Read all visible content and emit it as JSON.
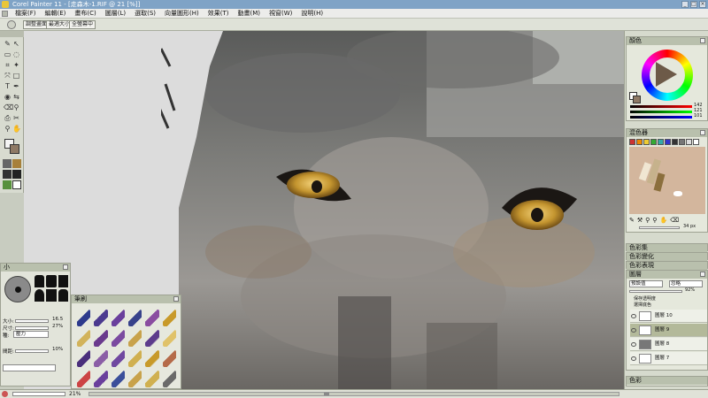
{
  "window": {
    "title": "Corel Painter 11 - [走森木-1.RIF @ 21 [%]]",
    "controls": [
      "_",
      "□",
      "×"
    ]
  },
  "menu": [
    "檔案(F)",
    "編輯(E)",
    "畫布(C)",
    "圖層(L)",
    "選取(S)",
    "向量圖形(H)",
    "效果(T)",
    "動畫(M)",
    "視窗(W)",
    "說明(H)"
  ],
  "property_bar": {
    "buttons": [
      "調整畫面",
      "最適大小",
      "全螢幕中"
    ]
  },
  "toolbox": {
    "title": ""
  },
  "size_panel": {
    "title": "小",
    "size_label": "大小:",
    "size_value": "16.5",
    "min_label": "尺寸:",
    "min_value": "27%",
    "type_label": "種:",
    "type_value": "壓力",
    "opacity_label": "間距:",
    "opacity_value": "10%"
  },
  "brush_panel": {
    "title": "筆刷"
  },
  "color_panel": {
    "title": "顏色",
    "rgb": {
      "r": "142",
      "g": "121",
      "b": "101"
    }
  },
  "mixer_panel": {
    "title": "混色器",
    "zoom": "34 px"
  },
  "collapsed_panels": [
    "色彩集",
    "色彩變化",
    "色彩表現"
  ],
  "layers_panel": {
    "title": "圖層",
    "mode": "預設值",
    "mode_option": "忽略",
    "opacity": "92%",
    "pick_up_label": "保存透明度",
    "pick_up_label2": "選擇底色",
    "layers": [
      {
        "name": "圖層 10",
        "selected": false
      },
      {
        "name": "圖層 9",
        "selected": true
      },
      {
        "name": "圖層 8",
        "selected": false
      },
      {
        "name": "圖層 7",
        "selected": false
      }
    ]
  },
  "channels_panel": {
    "title": "色彩"
  },
  "status": {
    "zoom": "21%"
  },
  "colors": {
    "accent_panel": "#b9c0ad",
    "selected_layer": "#b3b99a"
  }
}
